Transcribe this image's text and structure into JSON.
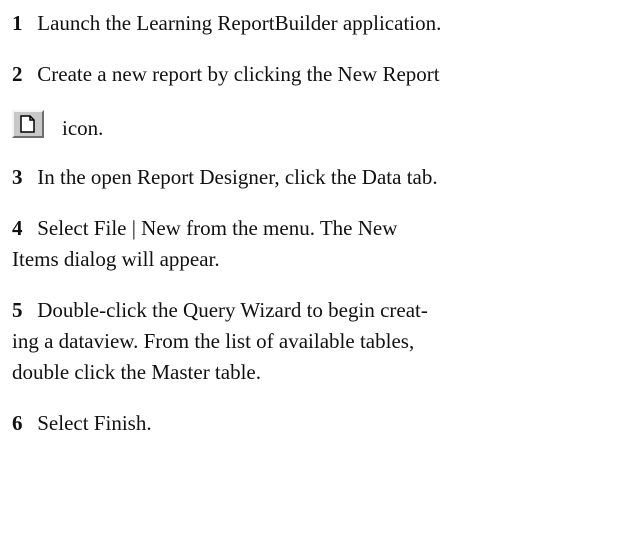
{
  "steps": [
    {
      "number": "1",
      "text": "Launch the Learning ReportBuilder application."
    },
    {
      "number": "2",
      "text": "Create a new report by clicking the New Report",
      "icon": "new-report-icon",
      "after_icon": "icon."
    },
    {
      "number": "3",
      "text": "In the open Report Designer, click the Data tab."
    },
    {
      "number": "4",
      "line1": "Select File | New from the menu.  The New",
      "line2": "Items dialog will appear."
    },
    {
      "number": "5",
      "line1": "Double-click the Query Wizard to begin creat-",
      "line2": "ing a dataview.  From the list of available tables,",
      "line3": "double click the Master table."
    },
    {
      "number": "6",
      "text": "Select Finish."
    }
  ]
}
